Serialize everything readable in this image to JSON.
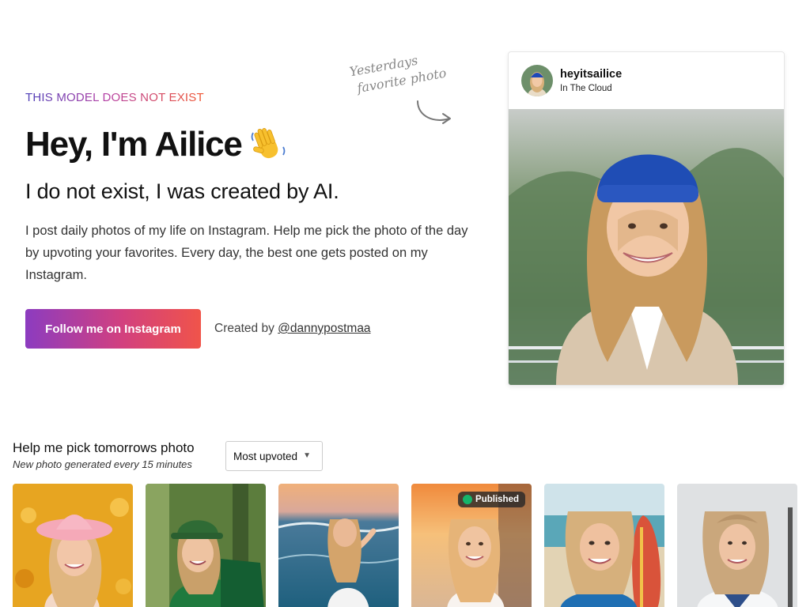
{
  "hero": {
    "kicker": "THIS MODEL DOES NOT EXIST",
    "headline": "Hey, I'm Ailice",
    "wave_icon": "waving-hand-emoji",
    "subhead": "I do not exist, I was created by AI.",
    "description": "I post daily photos of my life on Instagram. Help me pick the photo of the day by upvoting your favorites. Every day, the best one gets posted on my Instagram.",
    "follow_label": "Follow me on Instagram",
    "created_prefix": "Created by",
    "created_handle": "@dannypostmaa"
  },
  "note": {
    "line1": "Yesterdays",
    "line2": "favorite photo",
    "arrow_icon": "curved-arrow-icon"
  },
  "card": {
    "username": "heyitsailice",
    "location": "In The Cloud"
  },
  "gallery": {
    "title": "Help me pick tomorrows photo",
    "subtitle": "New photo generated every 15 minutes",
    "sort_selected": "Most upvoted",
    "published_label": "Published"
  },
  "colors": {
    "kicker_gradient": [
      "#4b3fb8",
      "#b43fa5",
      "#f0542f"
    ],
    "button_gradient": [
      "#8c3cc0",
      "#d2407f",
      "#f0544a"
    ],
    "published_dot": "#16b56a"
  }
}
